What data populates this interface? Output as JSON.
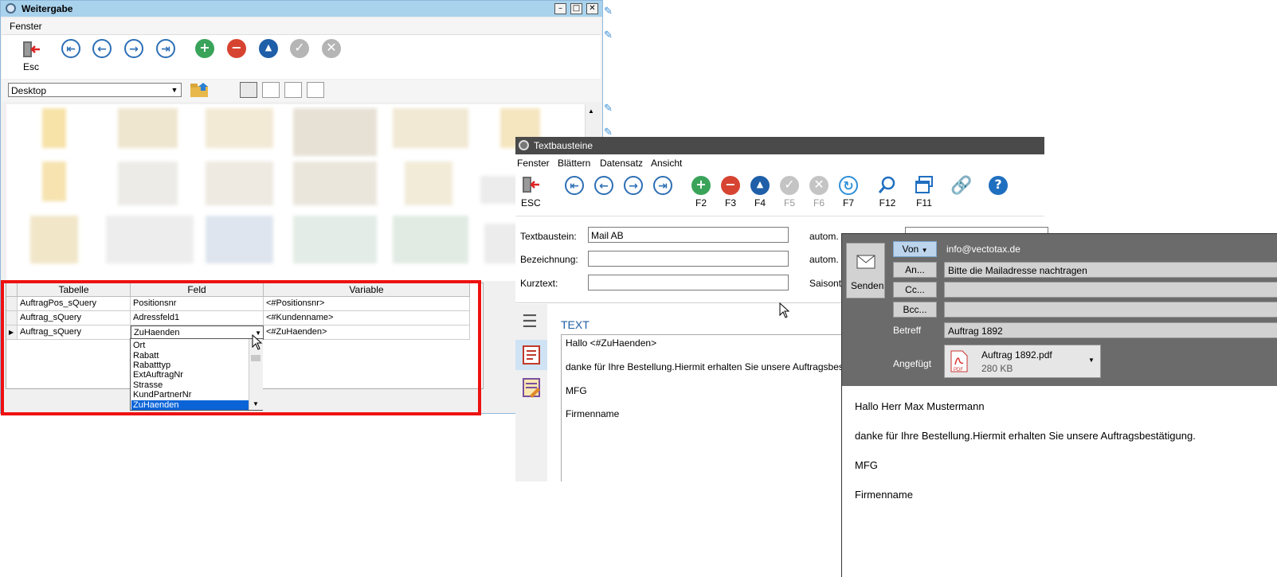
{
  "w1": {
    "title": "Weitergabe",
    "menu": "Fenster",
    "esc_label": "Esc",
    "path": "Desktop",
    "grid": {
      "headers": [
        "Tabelle",
        "Feld",
        "Variable"
      ],
      "rows": [
        [
          "AuftragPos_sQuery",
          "Positionsnr",
          "<#Positionsnr>"
        ],
        [
          "Auftrag_sQuery",
          "Adressfeld1",
          "<#Kundenname>"
        ],
        [
          "Auftrag_sQuery",
          "ZuHaenden",
          "<#ZuHaenden>"
        ]
      ],
      "dropdown_items": [
        "Ort",
        "Rabatt",
        "Rabatttyp",
        "ExtAuftragNr",
        "Strasse",
        "KundPartnerNr",
        "ZuHaenden"
      ],
      "dropdown_selected": "ZuHaenden"
    },
    "colors": {
      "highlight": "#ee1111",
      "selection": "#0a64d8"
    }
  },
  "w2": {
    "title": "Textbausteine",
    "menu": [
      "Fenster",
      "Blättern",
      "Datensatz",
      "Ansicht"
    ],
    "toolbar": {
      "esc": "ESC",
      "keys": [
        "F2",
        "F3",
        "F4",
        "F5",
        "F6",
        "F7",
        "F12",
        "F11"
      ]
    },
    "form": {
      "textbaustein_label": "Textbaustein:",
      "textbaustein_value": "Mail AB",
      "bezeichnung_label": "Bezeichnung:",
      "kurztext_label": "Kurztext:",
      "autom1": "autom.",
      "autom2": "autom.",
      "saison": "Saisonte"
    },
    "text_heading": "TEXT",
    "text_lines": [
      "Hallo <#ZuHaenden>",
      "danke für Ihre Bestellung.Hiermit erhalten Sie unsere Auftragsbestät",
      "MFG",
      "Firmenname"
    ]
  },
  "w3": {
    "send": "Senden",
    "von": "Von",
    "from_value": "info@vectotax.de",
    "an": "An...",
    "an_value": "Bitte die Mailadresse nachtragen",
    "cc": "Cc...",
    "bcc": "Bcc...",
    "betreff_label": "Betreff",
    "betreff_value": "Auftrag 1892",
    "angefuegt_label": "Angefügt",
    "attachment_name": "Auftrag 1892.pdf",
    "attachment_size": "280 KB",
    "pdf_badge": "PDF",
    "body": [
      "Hallo Herr Max Mustermann",
      "danke für Ihre Bestellung.Hiermit erhalten Sie unsere Auftragsbestätigung.",
      "MFG",
      "Firmenname"
    ]
  }
}
